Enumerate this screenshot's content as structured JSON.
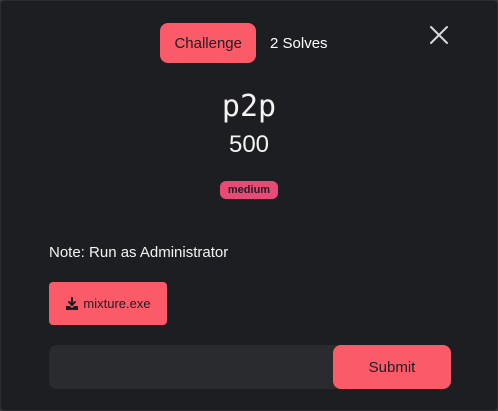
{
  "tabs": [
    {
      "label": "Challenge",
      "active": true
    },
    {
      "label": "2 Solves",
      "active": false
    }
  ],
  "challenge": {
    "name": "p2p",
    "value": "500",
    "tag": "medium",
    "description": "Note: Run as Administrator",
    "file": {
      "name": "mixture.exe",
      "icon": "download-icon"
    }
  },
  "form": {
    "input_value": "",
    "submit_label": "Submit"
  },
  "colors": {
    "background": "#1d1e21",
    "accent": "#fb5b68",
    "tag": "#e84a75",
    "input": "#2a2b2f"
  }
}
